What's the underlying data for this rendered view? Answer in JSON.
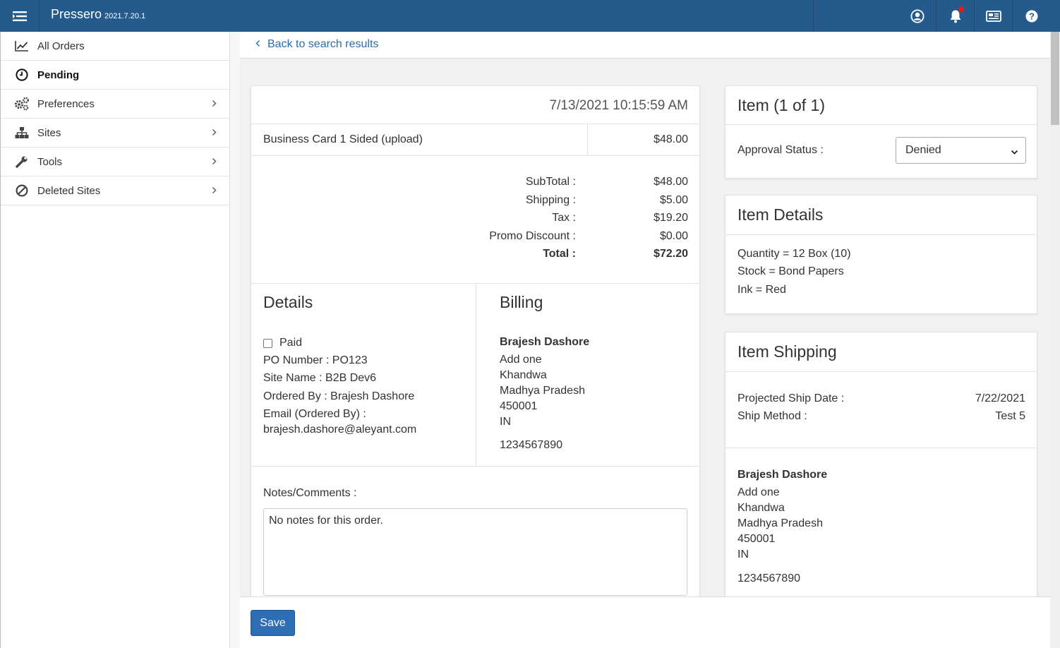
{
  "app": {
    "name": "Pressero",
    "version": "2021.7.20.1"
  },
  "colors": {
    "topbar": "#245a8c",
    "link": "#2a6bb0",
    "button": "#2d6db3",
    "notification_dot": "#e31b1b"
  },
  "topbar_icons": [
    "menu-icon",
    "user-icon",
    "bell-icon",
    "news-icon",
    "help-icon"
  ],
  "sidebar": {
    "items": [
      {
        "label": "All Orders",
        "icon": "chart-line-icon",
        "active": false,
        "has_children": false
      },
      {
        "label": "Pending",
        "icon": "clock-icon",
        "active": true,
        "has_children": false
      },
      {
        "label": "Preferences",
        "icon": "gears-icon",
        "active": false,
        "has_children": true
      },
      {
        "label": "Sites",
        "icon": "sitemap-icon",
        "active": false,
        "has_children": true
      },
      {
        "label": "Tools",
        "icon": "wrench-icon",
        "active": false,
        "has_children": true
      },
      {
        "label": "Deleted Sites",
        "icon": "ban-icon",
        "active": false,
        "has_children": true
      }
    ]
  },
  "back_link": "Back to search results",
  "order": {
    "datetime": "7/13/2021 10:15:59 AM",
    "product_name": "Business Card 1 Sided (upload)",
    "product_price": "$48.00",
    "totals": [
      {
        "label": "SubTotal :",
        "value": "$48.00"
      },
      {
        "label": "Shipping :",
        "value": "$5.00"
      },
      {
        "label": "Tax :",
        "value": "$19.20"
      },
      {
        "label": "Promo Discount :",
        "value": "$0.00"
      },
      {
        "label": "Total :",
        "value": "$72.20"
      }
    ],
    "details": {
      "title": "Details",
      "paid_label": "Paid",
      "paid_checked": false,
      "po_number": "PO Number : PO123",
      "site_name": "Site Name : B2B Dev6",
      "ordered_by": "Ordered By : Brajesh Dashore",
      "email_label": "Email (Ordered By) :",
      "email": "brajesh.dashore@aleyant.com"
    },
    "billing": {
      "title": "Billing",
      "name": "Brajesh Dashore",
      "address1": "Add one",
      "city": "Khandwa",
      "state": "Madhya Pradesh",
      "zip": "450001",
      "country": "IN",
      "phone": "1234567890"
    },
    "notes_label": "Notes/Comments :",
    "notes": "No notes for this order."
  },
  "item": {
    "title": "Item (1 of 1)",
    "approval_label": "Approval Status :",
    "approval_value": "Denied"
  },
  "item_details": {
    "title": "Item Details",
    "quantity": "Quantity = 12 Box (10)",
    "stock": "Stock = Bond Papers",
    "ink": "Ink = Red"
  },
  "item_shipping": {
    "title": "Item Shipping",
    "ship_date_label": "Projected Ship Date :",
    "ship_date": "7/22/2021",
    "method_label": "Ship Method :",
    "method": "Test 5",
    "name": "Brajesh Dashore",
    "address1": "Add one",
    "city": "Khandwa",
    "state": "Madhya Pradesh",
    "zip": "450001",
    "country": "IN",
    "phone": "1234567890"
  },
  "footer": {
    "save_label": "Save"
  }
}
